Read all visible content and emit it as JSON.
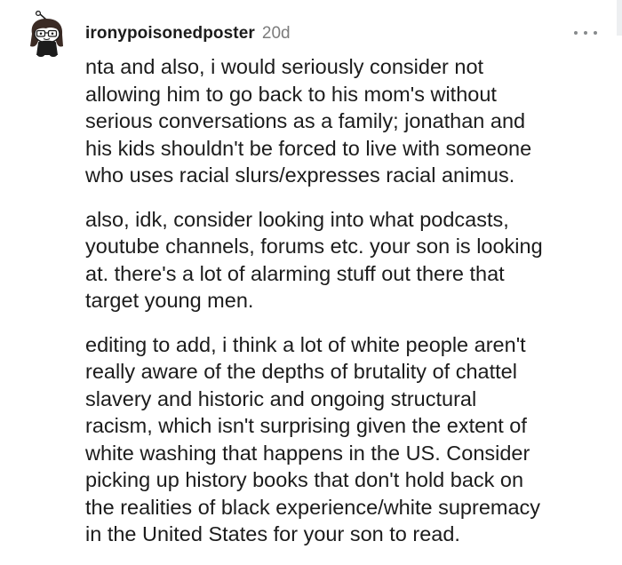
{
  "comment": {
    "username": "ironypoisonedposter",
    "age": "20d",
    "avatar_icon": "snoo-avatar-icon",
    "more_icon": "overflow-menu-icon",
    "paragraphs": [
      {
        "lines": [
          "nta and also, i would seriously consider not",
          "allowing him to go back to his mom's without",
          "serious conversations as a family; jonathan and",
          "his kids shouldn't be forced to live with someone",
          "who uses racial slurs/expresses racial animus."
        ]
      },
      {
        "lines": [
          "also, idk, consider looking into what podcasts,",
          "youtube channels, forums etc. your son is looking",
          "at. there's a lot of alarming stuff out there that",
          "target young men."
        ]
      },
      {
        "lines": [
          "editing to add, i think a lot of white people aren't",
          "really aware of the depths of brutality of chattel",
          "slavery and historic and ongoing structural",
          "racism, which isn't surprising given the extent of",
          "white washing that happens in the US. Consider",
          "picking up history books that don't hold back on",
          "the realities of black experience/white supremacy",
          "in the United States for your son to read."
        ]
      }
    ]
  },
  "colors": {
    "text": "#1c1c1c",
    "meta": "#7c7c7c",
    "icon": "#878a8c"
  }
}
